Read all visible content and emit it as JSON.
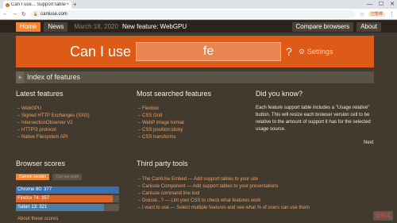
{
  "browser": {
    "tab_title": "Can I use... Support tables fo",
    "tab_close": "×",
    "new_tab": "+",
    "url": "caniuse.com",
    "controls": [
      "—",
      "☐",
      "✕"
    ],
    "pause_label": "已暂停"
  },
  "nav": {
    "home": "Home",
    "news": "News",
    "date": "March 18, 2020",
    "headline": "New feature: WebGPU",
    "compare": "Compare browsers",
    "about": "About"
  },
  "search": {
    "prefix": "Can I use",
    "value": "fe",
    "suffix": "?",
    "settings": "Settings"
  },
  "index": {
    "toggle": "+",
    "label": "Index of features"
  },
  "latest": {
    "title": "Latest features",
    "items": [
      "WebGPU",
      "Signed HTTP Exchanges (SXG)",
      "IntersectionObserver V2",
      "HTTP/3 protocol",
      "Native Filesystem API"
    ]
  },
  "most_searched": {
    "title": "Most searched features",
    "items": [
      "Flexbox",
      "CSS Grid",
      "WebP image format",
      "CSS position:sticky",
      "CSS transforms"
    ]
  },
  "did_you_know": {
    "title": "Did you know?",
    "text": "Each feature support table includes a \"Usage relative\" button. This will resize each browser version cell to be relative to the amount of support it has for the selected usage source.",
    "next": "Next"
  },
  "browser_scores": {
    "title": "Browser scores",
    "tab_current": "Current version",
    "tab_next": "Can we soon",
    "bars": [
      {
        "label": "Chrome 80: 377",
        "fraction": 1.0,
        "color": "#3d6fb0"
      },
      {
        "label": "Firefox 74: 357",
        "fraction": 0.94,
        "color": "#d9652a"
      },
      {
        "label": "Safari 13: 321",
        "fraction": 0.85,
        "color": "#4e7fa6"
      }
    ],
    "about": "About these scores"
  },
  "third_party": {
    "title": "Third party tools",
    "items": [
      "The CanIUse Embed — Add support tables to your site",
      "Caniuse Component — Add support tables to your presentations",
      "Caniuse command line tool",
      "Doiuse...? — Lint your CSS to check what features work",
      "I want to use — Select multiple features and see what % of users can use them"
    ]
  },
  "watermark": "值得买"
}
